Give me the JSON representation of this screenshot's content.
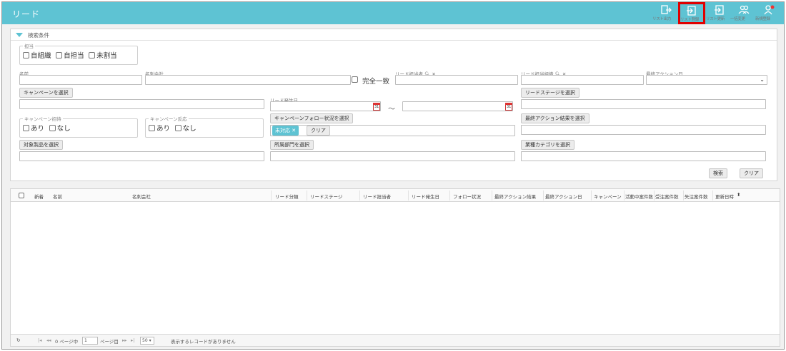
{
  "app": {
    "title": "リード"
  },
  "header_buttons": [
    {
      "label": "リスト出力",
      "icon": "export-icon"
    },
    {
      "label": "リスト登録",
      "icon": "list-register-icon"
    },
    {
      "label": "リスト更新",
      "icon": "list-update-icon"
    },
    {
      "label": "一括変更",
      "icon": "bulk-change-icon"
    },
    {
      "label": "新規登録",
      "icon": "new-register-icon"
    }
  ],
  "search": {
    "title": "検索条件",
    "owner_group": {
      "legend": "担当",
      "options": [
        "自組織",
        "自担当",
        "未割当"
      ]
    },
    "name_label": "名前",
    "company_label": "名刺会社",
    "exact_match": "完全一致",
    "lead_owner_label": "リード担当者",
    "lead_org_label": "リード担当組織",
    "last_action_date_label": "最終アクション日",
    "campaign_select": "キャンペーンを選択",
    "lead_date_label": "リード発生日",
    "range_sep": "〜",
    "calendar_day": "31",
    "lead_stage_select": "リードステージを選択",
    "campaign_invite": {
      "legend": "キャンペーン招待",
      "options": [
        "あり",
        "なし"
      ]
    },
    "campaign_response": {
      "legend": "キャンペーン反応",
      "options": [
        "あり",
        "なし"
      ]
    },
    "follow_status_select": "キャンペーンフォロー状況を選択",
    "follow_tag": "未対応",
    "follow_clear": "クリア",
    "last_action_result_select": "最終アクション結果を選択",
    "product_select": "対象製品を選択",
    "department_select": "所属部門を選択",
    "industry_select": "業種カテゴリを選択",
    "search_button": "検索",
    "clear_button": "クリア"
  },
  "grid": {
    "columns": [
      "新着",
      "名前",
      "名刺会社",
      "リード分類",
      "リードステージ",
      "リード担当者",
      "リード発生日",
      "フォロー状況",
      "最終アクション結果",
      "最終アクション日",
      "キャンペーン",
      "活動中案件数",
      "受注案件数",
      "失注案件数",
      "更新日時"
    ],
    "sort_indicator": "⬍"
  },
  "pager": {
    "refresh": "↻",
    "first": "|◂",
    "prev": "◂◂",
    "total": "0 ページ中",
    "current_page": "1",
    "page_suffix": "ページ目",
    "next": "▸▸",
    "last": "▸|",
    "page_size": "50",
    "empty_message": "表示するレコードがありません"
  },
  "colors": {
    "header": "#5ec3d3",
    "highlight": "#e00000"
  }
}
